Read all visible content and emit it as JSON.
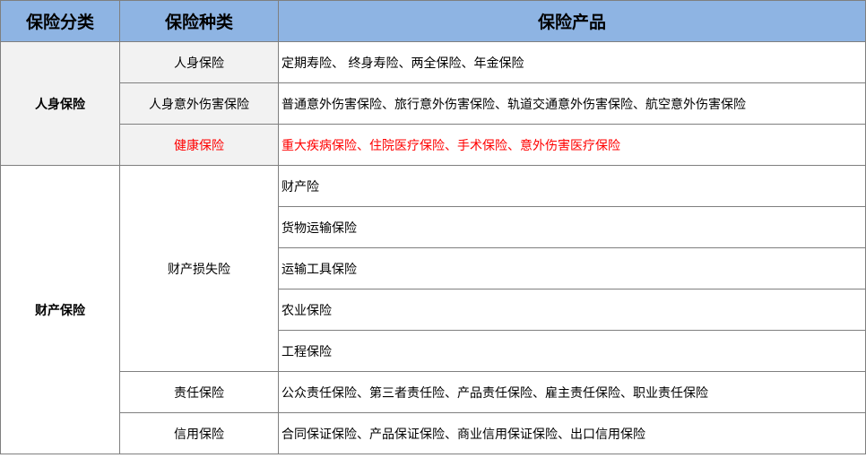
{
  "headers": {
    "category": "保险分类",
    "type": "保险种类",
    "products": "保险产品"
  },
  "colors": {
    "header_bg": "#8eb4e3",
    "highlight_text": "#ff0000",
    "shaded_bg": "#f2f2f2"
  },
  "personal": {
    "category": "人身保险",
    "rows": [
      {
        "type": "人身保险",
        "products": "定期寿险、 终身寿险、两全保险、年金保险"
      },
      {
        "type": "人身意外伤害保险",
        "products": "普通意外伤害保险、旅行意外伤害保险、轨道交通意外伤害保险、航空意外伤害保险"
      },
      {
        "type": "健康保险",
        "products": "重大疾病保险、住院医疗保险、手术保险、意外伤害医疗保险",
        "highlight": true
      }
    ]
  },
  "property": {
    "category": "财产保险",
    "loss": {
      "type": "财产损失险",
      "products": [
        "财产险",
        "货物运输保险",
        "运输工具保险",
        "农业保险",
        "工程保险"
      ]
    },
    "liability": {
      "type": "责任保险",
      "products": "公众责任保险、第三者责任险、产品责任保险、雇主责任保险、职业责任保险"
    },
    "credit": {
      "type": "信用保险",
      "products": "合同保证保险、产品保证保险、商业信用保证保险、出口信用保险"
    }
  }
}
